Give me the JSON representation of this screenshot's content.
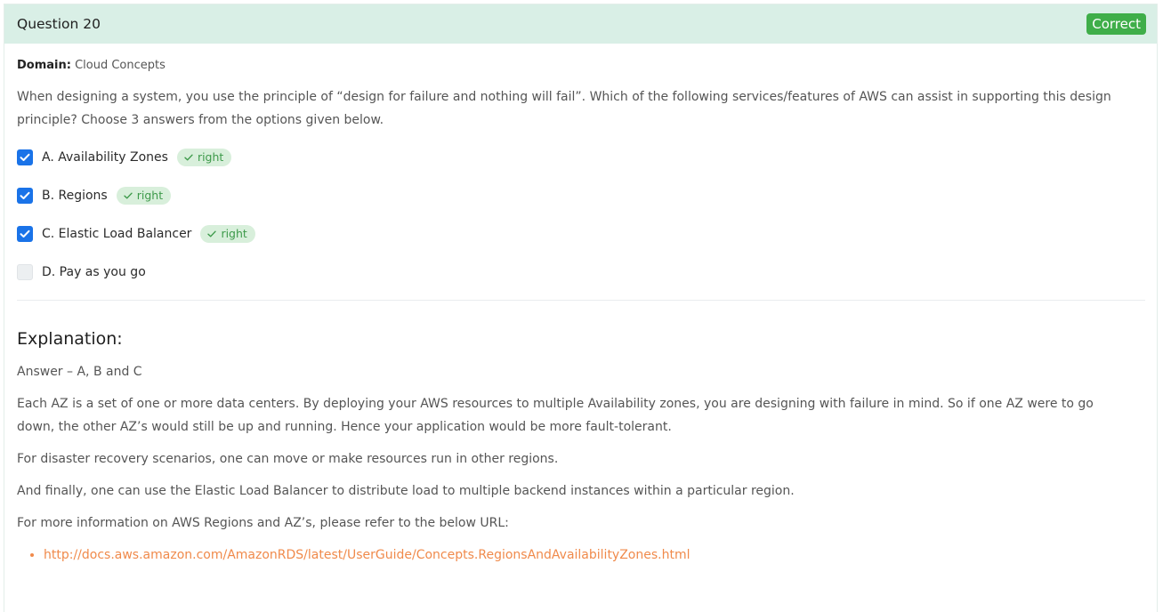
{
  "header": {
    "title": "Question 20",
    "status": "Correct",
    "status_color": "#3fae49",
    "background": "#d9efe6"
  },
  "domain": {
    "label": "Domain:",
    "value": "Cloud Concepts"
  },
  "question": {
    "text": "When designing a system, you use the principle of “design for failure and nothing will fail”. Which of the following services/features of AWS can assist in supporting this design principle? Choose 3 answers from the options given below."
  },
  "options": [
    {
      "label": "A. Availability Zones",
      "checked": true,
      "badge": "right"
    },
    {
      "label": "B. Regions",
      "checked": true,
      "badge": "right"
    },
    {
      "label": "C. Elastic Load Balancer",
      "checked": true,
      "badge": "right"
    },
    {
      "label": "D. Pay as you go",
      "checked": false,
      "badge": null
    }
  ],
  "explanation": {
    "title": "Explanation:",
    "answer": "Answer – A, B and C",
    "paragraphs": [
      "Each AZ is a set of one or more data centers. By deploying your AWS resources to multiple Availability zones, you are designing with failure in mind. So if one AZ were to go down, the other AZ’s would still be up and running. Hence your application would be more fault-tolerant.",
      "For disaster recovery scenarios, one can move or make resources run in other regions.",
      "And finally, one can use the Elastic Load Balancer to distribute load to multiple backend instances within a particular region.",
      "For more information on AWS Regions and AZ’s, please refer to the below URL:"
    ],
    "links": [
      "http://docs.aws.amazon.com/AmazonRDS/latest/UserGuide/Concepts.RegionsAndAvailabilityZones.html"
    ]
  },
  "colors": {
    "checkbox_checked": "#1a73e8",
    "badge_bg": "#d8efdb",
    "badge_text": "#3d9a4a",
    "link": "#f08a4b"
  },
  "icons": {
    "checkbox": "check-icon",
    "badge": "check-icon"
  }
}
